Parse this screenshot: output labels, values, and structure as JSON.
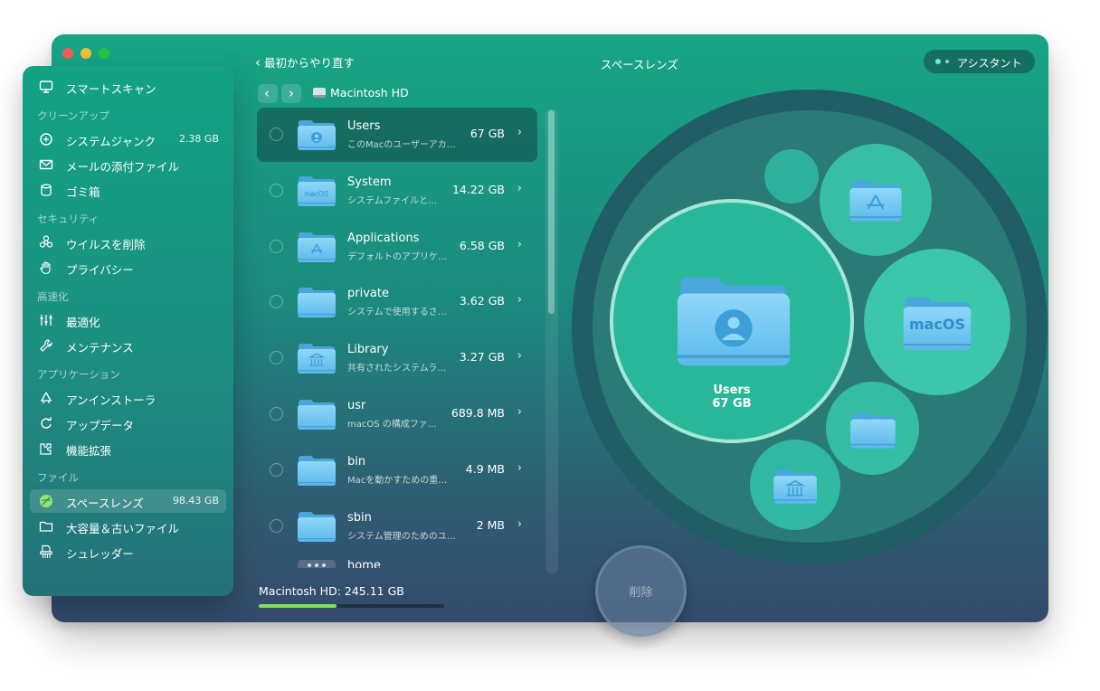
{
  "sidebar": {
    "smart_scan": "スマートスキャン",
    "sections": {
      "cleanup": "クリーンアップ",
      "security": "セキュリティ",
      "speed": "高速化",
      "apps": "アプリケーション",
      "files": "ファイル"
    },
    "items": [
      {
        "label": "システムジャンク",
        "size": "2.38 GB",
        "icon": "junk-icon"
      },
      {
        "label": "メールの添付ファイル",
        "size": "",
        "icon": "mail-icon"
      },
      {
        "label": "ゴミ箱",
        "size": "",
        "icon": "trash-icon"
      },
      {
        "label": "ウイルスを削除",
        "size": "",
        "icon": "biohazard-icon"
      },
      {
        "label": "プライバシー",
        "size": "",
        "icon": "hand-icon"
      },
      {
        "label": "最適化",
        "size": "",
        "icon": "sliders-icon"
      },
      {
        "label": "メンテナンス",
        "size": "",
        "icon": "wrench-icon"
      },
      {
        "label": "アンインストーラ",
        "size": "",
        "icon": "uninstaller-icon"
      },
      {
        "label": "アップデータ",
        "size": "",
        "icon": "updater-icon"
      },
      {
        "label": "機能拡張",
        "size": "",
        "icon": "extensions-icon"
      },
      {
        "label": "スペースレンズ",
        "size": "98.43 GB",
        "icon": "space-lens-icon"
      },
      {
        "label": "大容量＆古いファイル",
        "size": "",
        "icon": "folder-icon"
      },
      {
        "label": "シュレッダー",
        "size": "",
        "icon": "shredder-icon"
      }
    ]
  },
  "header": {
    "back_label": "最初からやり直す",
    "title": "スペースレンズ",
    "assistant_label": "アシスタント"
  },
  "browser": {
    "location": "Macintosh HD",
    "rows": [
      {
        "name": "Users",
        "desc": "このMacのユーザーアカ…",
        "size": "67 GB",
        "emblem": "user"
      },
      {
        "name": "System",
        "desc": "システムファイルと…",
        "size": "14.22 GB",
        "emblem": "macOS"
      },
      {
        "name": "Applications",
        "desc": "デフォルトのアプリケ…",
        "size": "6.58 GB",
        "emblem": "app"
      },
      {
        "name": "private",
        "desc": "システムで使用するさ…",
        "size": "3.62 GB",
        "emblem": ""
      },
      {
        "name": "Library",
        "desc": "共有されたシステムラ…",
        "size": "3.27 GB",
        "emblem": "library"
      },
      {
        "name": "usr",
        "desc": "macOS の構成ファ…",
        "size": "689.8 MB",
        "emblem": ""
      },
      {
        "name": "bin",
        "desc": "Macを動かすための重…",
        "size": "4.9 MB",
        "emblem": ""
      },
      {
        "name": "sbin",
        "desc": "システム管理のためのユー…",
        "size": "2 MB",
        "emblem": ""
      },
      {
        "name": "home",
        "desc": "",
        "size": "",
        "emblem": ""
      }
    ],
    "disk_label": "Macintosh HD: 245.11 GB",
    "disk_used_fraction": 0.42
  },
  "lens": {
    "center_name": "Users",
    "center_size": "67 GB",
    "macos_badge": "macOS"
  },
  "delete_label": "削除",
  "colors": {
    "accent_green": "#86e05a",
    "folder_blue": "#6ec6f2",
    "window_top": "#17a584",
    "window_bottom": "#344a6b"
  }
}
